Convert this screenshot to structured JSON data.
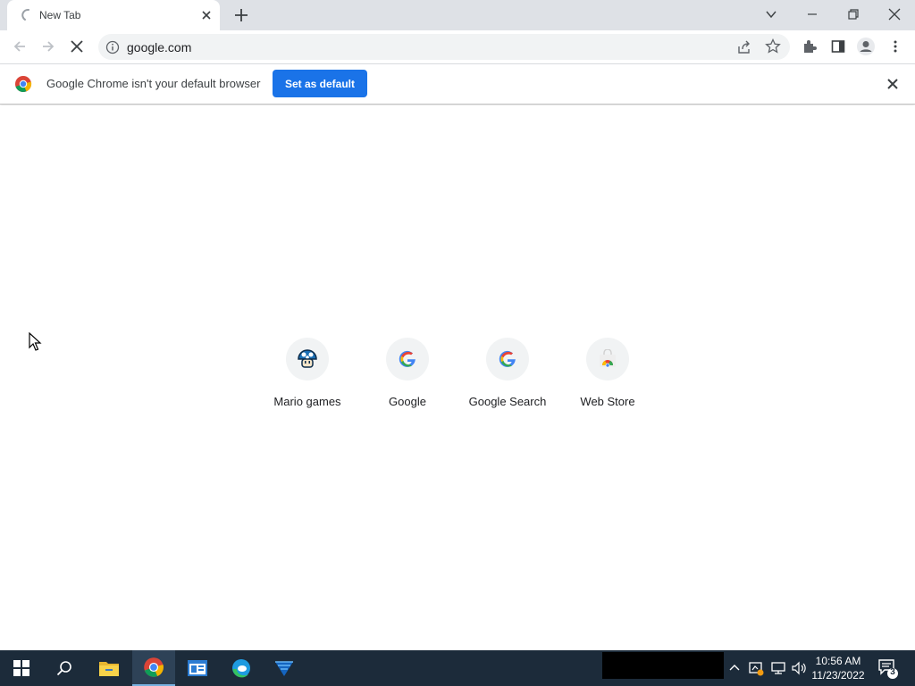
{
  "browser": {
    "tab_title": "New Tab",
    "address": "google.com"
  },
  "infobar": {
    "message": "Google Chrome isn't your default browser",
    "button_label": "Set as default"
  },
  "shortcuts": [
    {
      "label": "Mario games",
      "icon": "mario-mushroom-icon"
    },
    {
      "label": "Google",
      "icon": "google-g-icon"
    },
    {
      "label": "Google Search",
      "icon": "google-g-icon"
    },
    {
      "label": "Web Store",
      "icon": "webstore-icon"
    }
  ],
  "taskbar": {
    "time": "10:56 AM",
    "date": "11/23/2022",
    "notification_count": "3"
  },
  "colors": {
    "accent": "#1a73e8",
    "tabstrip": "#dee1e6",
    "taskbar": "#1c2b3a"
  }
}
